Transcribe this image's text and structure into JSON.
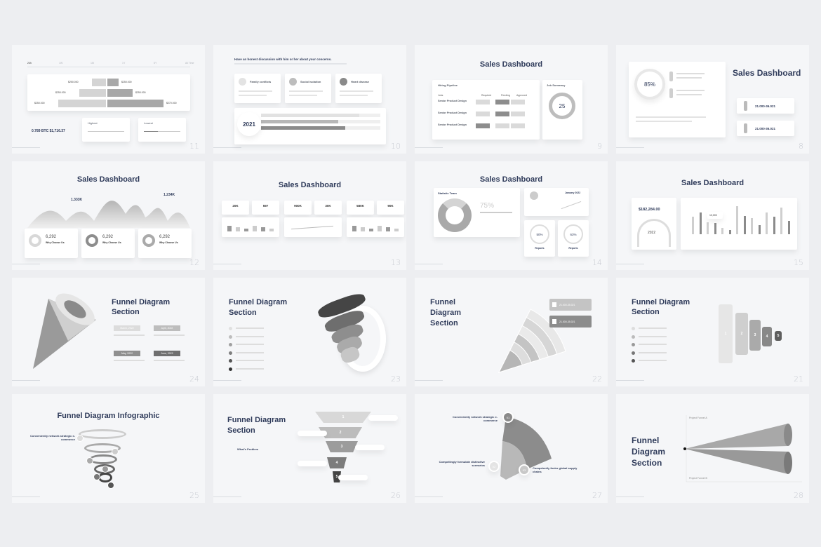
{
  "colors": {
    "background": "#edeef1",
    "slide": "#f5f6f8",
    "title": "#2f3b5a",
    "gray_light": "#d6d6d6",
    "gray_mid": "#a6a6a6",
    "gray_dark": "#5e5e5e"
  },
  "slides": [
    {
      "number": "11",
      "tabs": [
        "24h",
        "1W",
        "1M",
        "1Y",
        "5Y",
        "All Time"
      ],
      "left_values": [
        "$250.000",
        "$250.000",
        "$250.000"
      ],
      "right_values": [
        "$250.000",
        "$250.000",
        "$270.000"
      ],
      "balance": "0.789 BTC $1,716.37",
      "highest": "Highest",
      "lowest": "Lowest"
    },
    {
      "number": "10",
      "heading": "Have an honest discussion with him or her about your concerns.",
      "cards": [
        "Family conflicts",
        "Social isolation",
        "Heart disease"
      ],
      "year": "2021"
    },
    {
      "number": "9",
      "title": "Sales Dashboard",
      "pipeline": "Hiring Pipeline",
      "summary": "Job Summary",
      "columns": [
        "Jobs",
        "Required",
        "Pending",
        "Approved"
      ],
      "rows": [
        "Senior Product Design",
        "Senior Product Design",
        "Senior Product Design"
      ],
      "donut_value": "25"
    },
    {
      "number": "8",
      "title": "Sales Dashboard",
      "percent": "85%",
      "ranges": [
        "21.000-36.021",
        "21.000-36.021"
      ]
    },
    {
      "number": "12",
      "title": "Sales Dashboard",
      "peaks": [
        "1.333K",
        "1.234K"
      ],
      "cards": [
        {
          "value": "6,292",
          "label": "Why Choose Us"
        },
        {
          "value": "6,292",
          "label": "Why Choose Us"
        },
        {
          "value": "6,292",
          "label": "Why Choose Us"
        }
      ]
    },
    {
      "number": "13",
      "title": "Sales Dashboard",
      "stats": [
        "20K",
        "597",
        "900K",
        "30K",
        "580K",
        "90K"
      ]
    },
    {
      "number": "14",
      "title": "Sales Dashboard",
      "team": "Statistic Team",
      "percent": "75%",
      "date": "January 2022",
      "gauges": [
        "50%",
        "63%"
      ],
      "reports": "Reports"
    },
    {
      "number": "15",
      "title": "Sales Dashboard",
      "amount": "$182,284.00",
      "year": "2022",
      "tooltip": "13,000",
      "bars": [
        60,
        75,
        40,
        38,
        22,
        15,
        95,
        62,
        55,
        32,
        75,
        60,
        90,
        45
      ]
    },
    {
      "number": "24",
      "title": "Funnel Diagram Section",
      "tags": [
        "March, 2022",
        "April, 2022",
        "May, 2022",
        "June, 2022"
      ]
    },
    {
      "number": "23",
      "title": "Funnel Diagram Section"
    },
    {
      "number": "22",
      "title": "Funnel Diagram Section",
      "cards": [
        "21.000-35.021",
        "21.000-35.021"
      ]
    },
    {
      "number": "21",
      "title": "Funnel Diagram Section",
      "steps": [
        "1",
        "2",
        "3",
        "4",
        "5"
      ]
    },
    {
      "number": "25",
      "title": "Funnel Diagram Infographic",
      "lead": "Conveniently network strategic e-commerce"
    },
    {
      "number": "26",
      "title": "Funnel Diagram Section",
      "steps": [
        "1",
        "2",
        "3",
        "4",
        "5"
      ],
      "problem": "What's Problem"
    },
    {
      "number": "27",
      "points": [
        {
          "n": "01",
          "text": "Conveniently network strategic e-commerce"
        },
        {
          "n": "02",
          "text": "Compellingly formulate distinctive scenarios"
        },
        {
          "n": "03",
          "text": "Competently foster global supply chains"
        }
      ]
    },
    {
      "number": "28",
      "title": "Funnel Diagram Section",
      "funnels": [
        "Project Funnel A",
        "Project Funnel B"
      ]
    }
  ]
}
